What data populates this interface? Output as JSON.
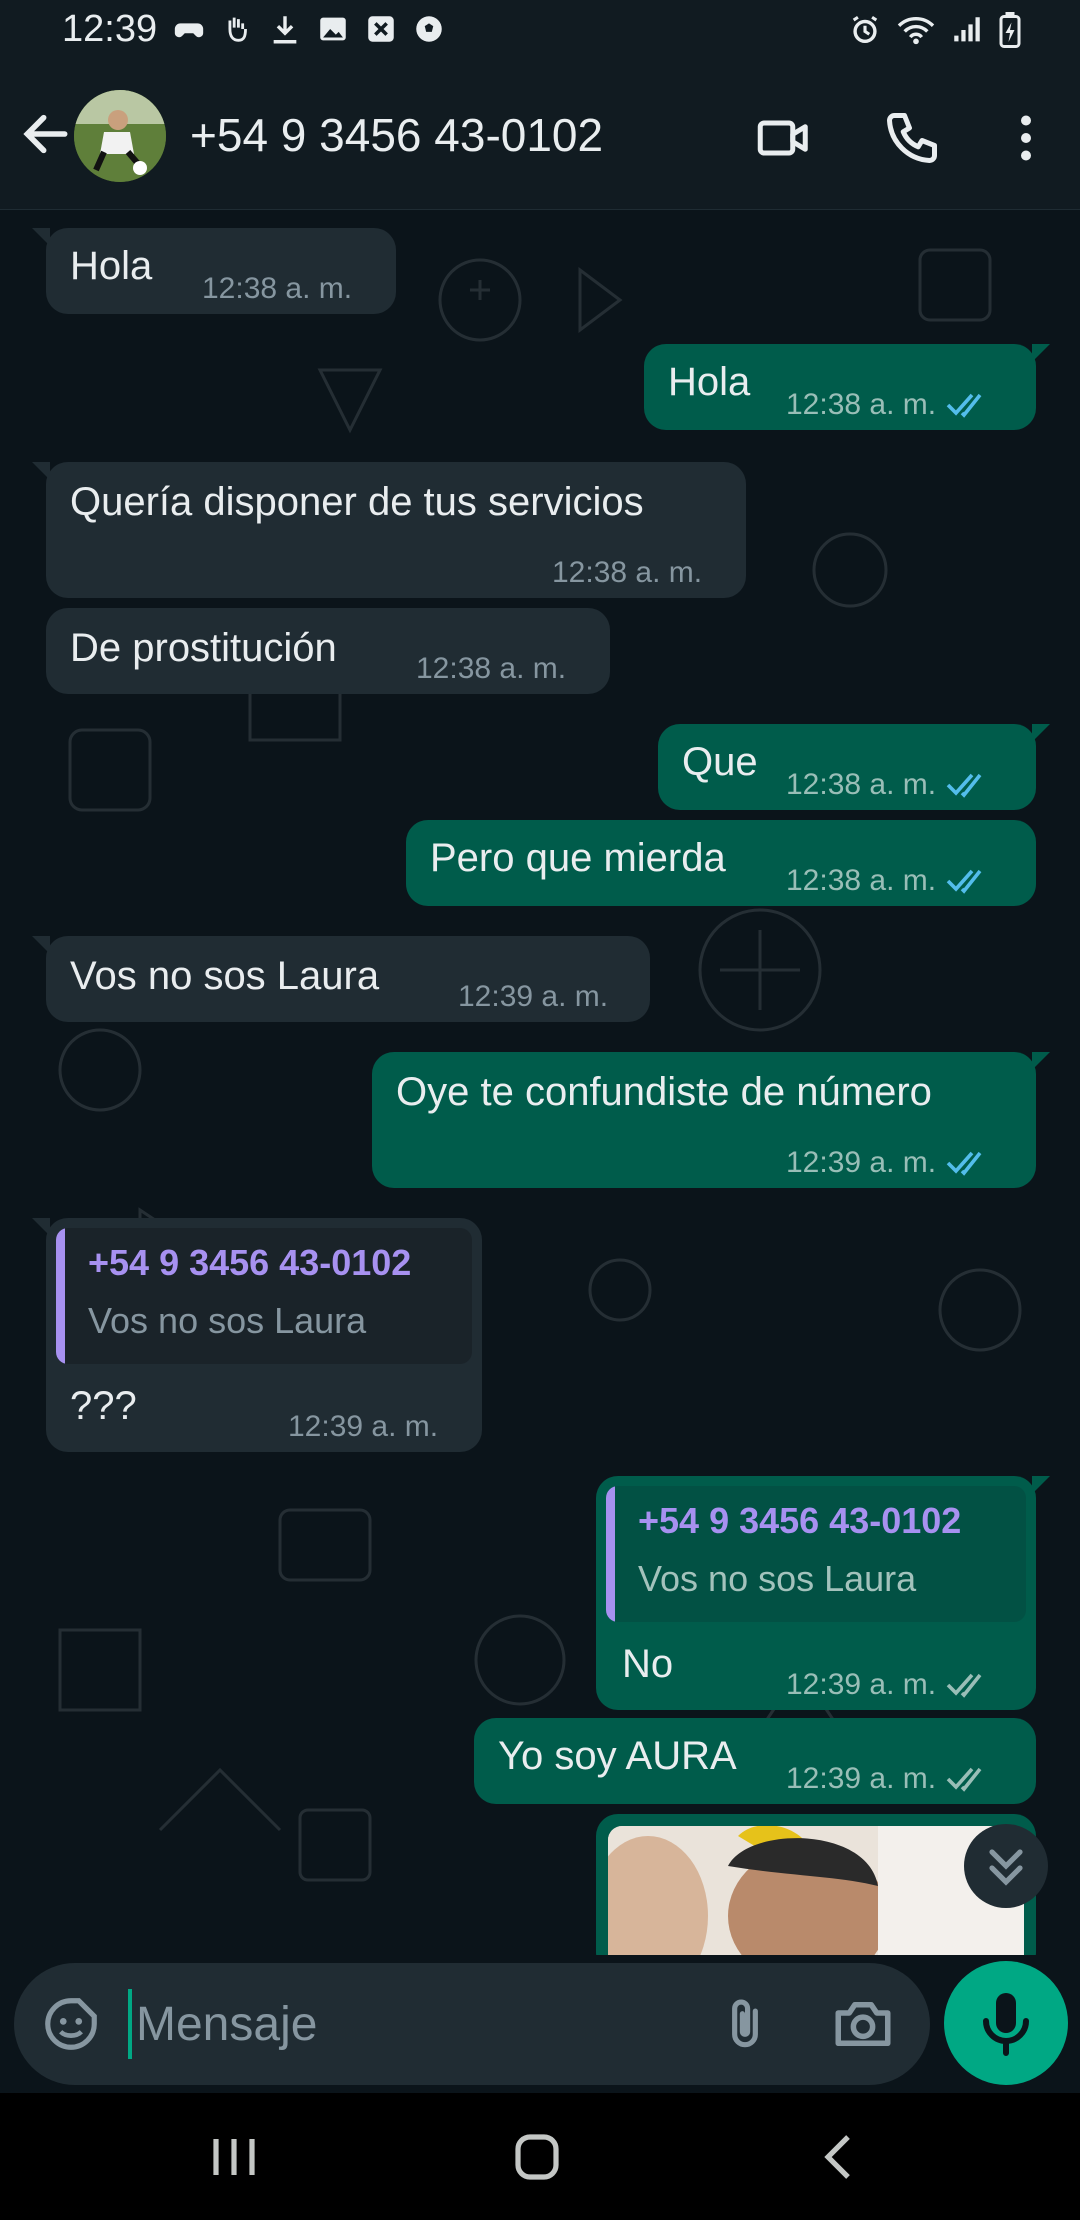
{
  "status_bar": {
    "time": "12:39"
  },
  "header": {
    "contact_name": "+54 9 3456 43-0102"
  },
  "messages": [
    {
      "text": "Hola",
      "time": "12:38 a. m."
    },
    {
      "text": "Hola",
      "time": "12:38 a. m.",
      "ticks": "read"
    },
    {
      "text": "Quería disponer de tus servicios",
      "time": "12:38 a. m."
    },
    {
      "text": "De prostitución",
      "time": "12:38 a. m."
    },
    {
      "text": "Que",
      "time": "12:38 a. m.",
      "ticks": "read"
    },
    {
      "text": "Pero que mierda",
      "time": "12:38 a. m.",
      "ticks": "read"
    },
    {
      "text": "Vos no sos Laura",
      "time": "12:39 a. m."
    },
    {
      "text": "Oye te confundiste de número",
      "time": "12:39 a. m.",
      "ticks": "read"
    },
    {
      "quote_author": "+54 9 3456 43-0102",
      "quote_text": "Vos no sos Laura",
      "text": "???",
      "time": "12:39 a. m."
    },
    {
      "quote_author": "+54 9 3456 43-0102",
      "quote_text": "Vos no sos Laura",
      "text": "No",
      "time": "12:39 a. m.",
      "ticks": "delivered"
    },
    {
      "text": "Yo soy AURA",
      "time": "12:39 a. m.",
      "ticks": "delivered"
    }
  ],
  "input": {
    "placeholder": "Mensaje"
  },
  "icons": {
    "back": "arrow-left-icon",
    "video": "video-call-icon",
    "call": "phone-icon",
    "menu": "more-vertical-icon",
    "emoji": "sticker-emoji-icon",
    "attach": "paperclip-icon",
    "camera": "camera-icon",
    "mic": "microphone-icon",
    "scroll": "double-chevron-down-icon"
  },
  "colors": {
    "background": "#0b141a",
    "incoming_bubble": "#202c33",
    "outgoing_bubble": "#005c4b",
    "accent": "#00a884",
    "read_ticks": "#53bdeb",
    "quote_author": "#a791f0"
  }
}
